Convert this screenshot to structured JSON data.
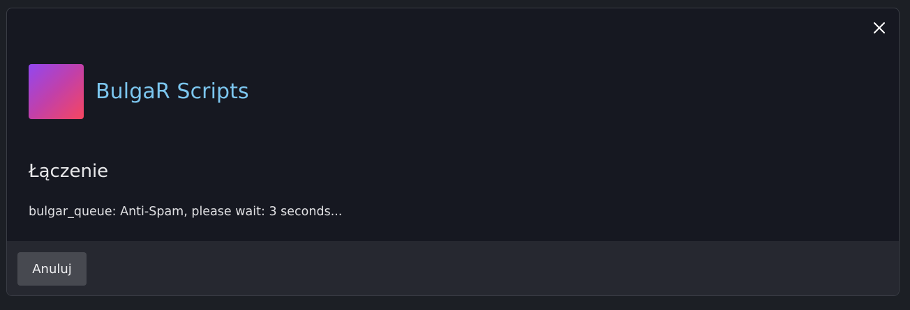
{
  "dialog": {
    "close_icon": "close-icon",
    "server": {
      "name": "BulgaR Scripts",
      "logo_gradient": [
        "#9247f0",
        "#f7465f"
      ]
    },
    "status_title": "Łączenie",
    "status_message": "bulgar_queue: Anti-Spam, please wait: 3 seconds...",
    "cancel_label": "Anuluj"
  },
  "colors": {
    "accent": "#7cc6ef",
    "dialog_bg": "#161821",
    "footer_bg": "#262830",
    "button_bg": "#474950"
  }
}
